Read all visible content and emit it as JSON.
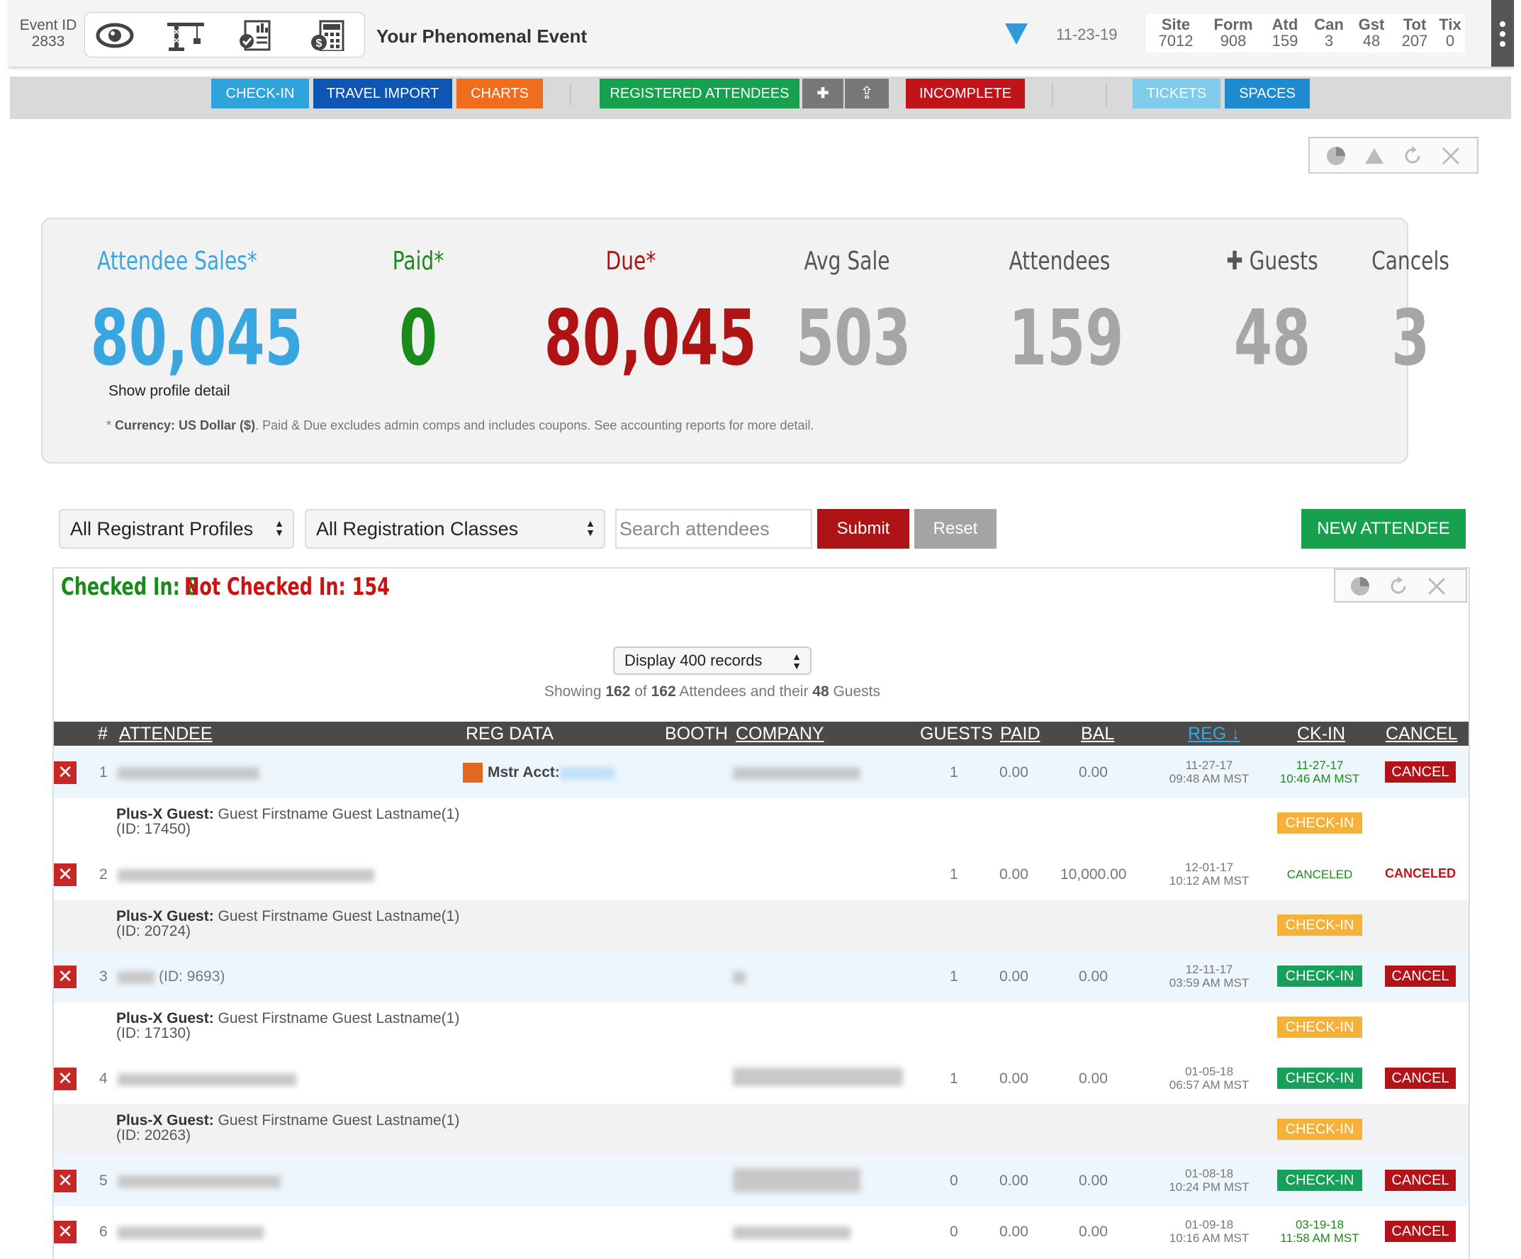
{
  "header": {
    "event_id_label": "Event ID",
    "event_id": "2833",
    "event_title": "Your Phenomenal Event",
    "event_date": "11-23-19",
    "tools": [
      "eye-icon",
      "crane-icon",
      "report-icon",
      "calculator-icon"
    ],
    "stats": [
      {
        "label": "Site",
        "value": "7012"
      },
      {
        "label": "Form",
        "value": "908"
      },
      {
        "label": "Atd",
        "value": "159"
      },
      {
        "label": "Can",
        "value": "3"
      },
      {
        "label": "Gst",
        "value": "48"
      },
      {
        "label": "Tot",
        "value": "207"
      },
      {
        "label": "Tix",
        "value": "0"
      }
    ]
  },
  "nav": {
    "check_in": "CHECK-IN",
    "travel_import": "TRAVEL IMPORT",
    "charts": "CHARTS",
    "registered_attendees": "REGISTERED ATTENDEES",
    "plus": "✚",
    "upload": "⇪",
    "incomplete": "INCOMPLETE",
    "tickets": "TICKETS",
    "spaces": "SPACES"
  },
  "summary": {
    "attendee_sales_label": "Attendee Sales*",
    "attendee_sales": "80,045",
    "paid_label": "Paid*",
    "paid": "0",
    "due_label": "Due*",
    "due": "80,045",
    "avg_sale_label": "Avg Sale",
    "avg_sale": "503",
    "attendees_label": "Attendees",
    "attendees": "159",
    "guests_label": "✚ Guests",
    "guests": "48",
    "cancels_label": "Cancels",
    "cancels": "3",
    "profile_link": "Show profile detail",
    "currency_prefix": "* ",
    "currency_bold": "Currency: US Dollar ($)",
    "currency_rest": ". Paid & Due excludes admin comps and includes coupons. See accounting reports for more detail."
  },
  "filters": {
    "profiles": "All Registrant Profiles",
    "classes": "All Registration Classes",
    "search_placeholder": "Search attendees",
    "submit": "Submit",
    "reset": "Reset",
    "new_attendee": "NEW ATTENDEE"
  },
  "list": {
    "checked_in": "Checked In: 8",
    "not_checked_in": "Not Checked In: 154",
    "display": "Display 400 records",
    "showing_1": "Showing ",
    "showing_n": "162",
    "showing_2": " of ",
    "showing_total": "162",
    "showing_3": " Attendees and their ",
    "showing_guests": "48",
    "showing_4": " Guests",
    "columns": {
      "num": "#",
      "attendee": "ATTENDEE",
      "reg_data": "REG DATA",
      "booth": "BOOTH",
      "company": "COMPANY",
      "guests": "GUESTS",
      "paid": "PAID",
      "bal": "BAL",
      "reg": "REG ↓",
      "ckin": "CK-IN",
      "cancel": "CANCEL"
    },
    "master_acct_label": "Mstr Acct:",
    "guest_label": "Plus-X Guest:",
    "guest_name": "Guest Firstname Guest Lastname(1)",
    "rows": [
      {
        "num": "1",
        "guests": "1",
        "paid": "0.00",
        "bal": "0.00",
        "reg_date": "11-27-17",
        "reg_time": "09:48 AM MST",
        "ck_date": "11-27-17",
        "ck_time": "10:46 AM MST",
        "cancel": "CANCEL",
        "guest_id": "(ID: 17450)",
        "guest_btn": "CHECK-IN"
      },
      {
        "num": "2",
        "guests": "1",
        "paid": "0.00",
        "bal": "10,000.00",
        "reg_date": "12-01-17",
        "reg_time": "10:12 AM MST",
        "ck_status": "CANCELED",
        "cancel": "CANCELED",
        "guest_id": "(ID: 20724)",
        "guest_btn": "CHECK-IN"
      },
      {
        "num": "3",
        "id_text": "(ID: 9693)",
        "guests": "1",
        "paid": "0.00",
        "bal": "0.00",
        "reg_date": "12-11-17",
        "reg_time": "03:59 AM MST",
        "ck_btn": "CHECK-IN",
        "cancel": "CANCEL",
        "guest_id": "(ID: 17130)",
        "guest_btn": "CHECK-IN"
      },
      {
        "num": "4",
        "guests": "1",
        "paid": "0.00",
        "bal": "0.00",
        "reg_date": "01-05-18",
        "reg_time": "06:57 AM MST",
        "ck_btn": "CHECK-IN",
        "cancel": "CANCEL",
        "guest_id": "(ID: 20263)",
        "guest_btn": "CHECK-IN"
      },
      {
        "num": "5",
        "guests": "0",
        "paid": "0.00",
        "bal": "0.00",
        "reg_date": "01-08-18",
        "reg_time": "10:24 PM MST",
        "ck_btn": "CHECK-IN",
        "cancel": "CANCEL"
      },
      {
        "num": "6",
        "guests": "0",
        "paid": "0.00",
        "bal": "0.00",
        "reg_date": "01-09-18",
        "reg_time": "10:16 AM MST",
        "ck_date": "03-19-18",
        "ck_time": "11:58 AM MST",
        "cancel": "CANCEL"
      }
    ]
  },
  "colors": {
    "sales": "#3aa6e0",
    "paid": "#1a8a1a",
    "due": "#b01313",
    "gray_stat": "#a6a6a6",
    "check_in_btn": "#16a05a",
    "cancel_btn": "#b31217",
    "guest_btn": "#f6b13a"
  }
}
